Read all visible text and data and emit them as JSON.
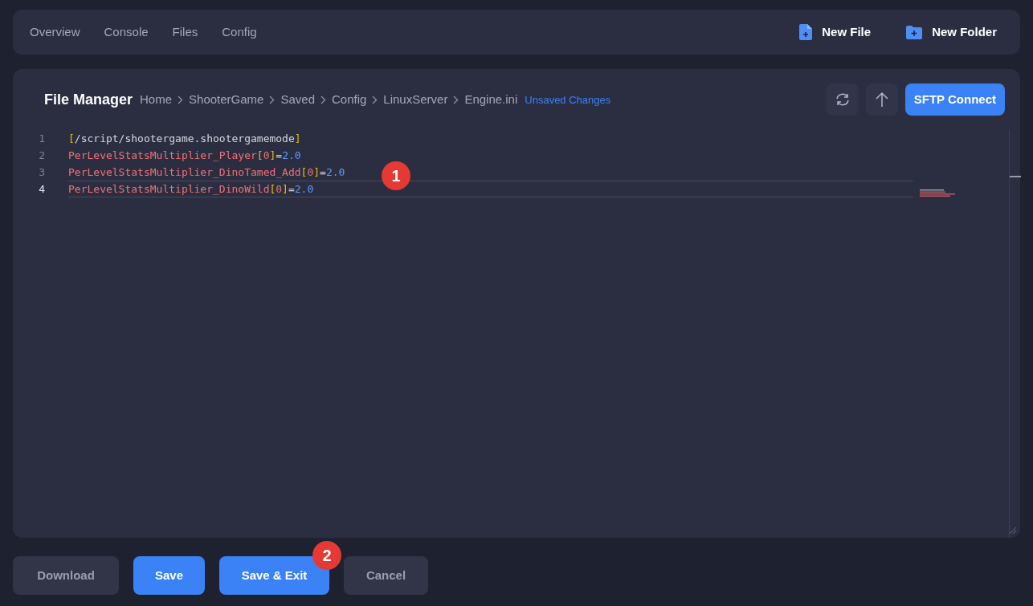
{
  "nav": {
    "tabs": [
      {
        "label": "Overview",
        "selected": false
      },
      {
        "label": "Console",
        "selected": false
      },
      {
        "label": "Files",
        "selected": false
      },
      {
        "label": "Config",
        "selected": false
      }
    ],
    "actions": [
      {
        "label": "New File",
        "kind": "file"
      },
      {
        "label": "New Folder",
        "kind": "folder"
      }
    ]
  },
  "file_manager": {
    "title": "File Manager",
    "breadcrumb": [
      "Home",
      "ShooterGame",
      "Saved",
      "Config",
      "LinuxServer",
      "Engine.ini"
    ],
    "status": "Unsaved Changes",
    "sftp_button": "SFTP Connect"
  },
  "editor": {
    "lines": [
      {
        "number": "1",
        "current": false,
        "tokens": [
          {
            "kind": "bracket",
            "text": "["
          },
          {
            "kind": "plain",
            "text": "/script/shootergame.shootergamemode"
          },
          {
            "kind": "bracket",
            "text": "]"
          }
        ]
      },
      {
        "number": "2",
        "current": false,
        "tokens": [
          {
            "kind": "key",
            "text": "PerLevelStatsMultiplier_Player"
          },
          {
            "kind": "bracket",
            "text": "["
          },
          {
            "kind": "key",
            "text": "0"
          },
          {
            "kind": "bracket",
            "text": "]"
          },
          {
            "kind": "plain",
            "text": "="
          },
          {
            "kind": "number",
            "text": "2.0"
          }
        ]
      },
      {
        "number": "3",
        "current": false,
        "tokens": [
          {
            "kind": "key",
            "text": "PerLevelStatsMultiplier_DinoTamed_Add"
          },
          {
            "kind": "bracket",
            "text": "["
          },
          {
            "kind": "key",
            "text": "0"
          },
          {
            "kind": "bracket",
            "text": "]"
          },
          {
            "kind": "plain",
            "text": "="
          },
          {
            "kind": "number",
            "text": "2.0"
          }
        ]
      },
      {
        "number": "4",
        "current": true,
        "tokens": [
          {
            "kind": "key",
            "text": "PerLevelStatsMultiplier_DinoWild"
          },
          {
            "kind": "bracket",
            "text": "["
          },
          {
            "kind": "key",
            "text": "0"
          },
          {
            "kind": "bracket",
            "text": "]"
          },
          {
            "kind": "plain",
            "text": "="
          },
          {
            "kind": "number",
            "text": "2.0"
          }
        ]
      }
    ]
  },
  "buttons": [
    {
      "label": "Download",
      "kind": "secondary"
    },
    {
      "label": "Save",
      "kind": "primary"
    },
    {
      "label": "Save & Exit",
      "kind": "primary"
    },
    {
      "label": "Cancel",
      "kind": "secondary"
    }
  ],
  "markers": [
    "1",
    "2"
  ]
}
